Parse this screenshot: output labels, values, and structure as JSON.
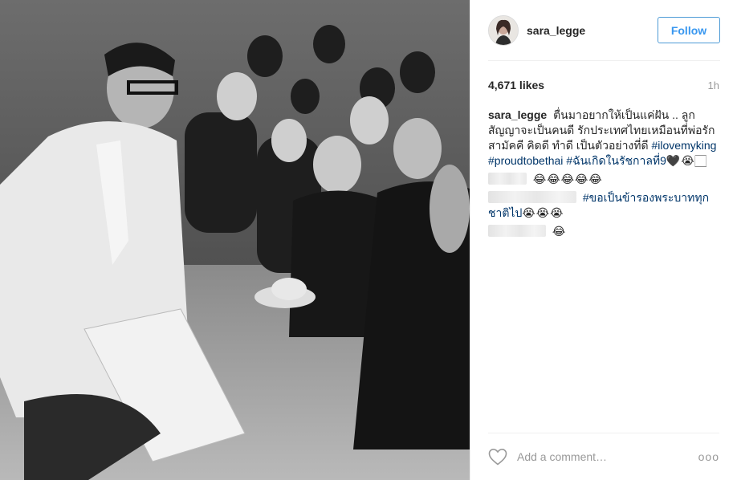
{
  "post": {
    "photo_alt": "",
    "header": {
      "username": "sara_legge",
      "follow_label": "Follow"
    },
    "likes": "4,671 likes",
    "time": "1h",
    "caption": {
      "username": "sara_legge",
      "text": "ตื่นมาอยากให้เป็นแค่ฝัน .. ลูกสัญญาจะเป็นคนดี รักประเทศไทยเหมือนที่พ่อรัก สามัคคี คิดดี ทำดี เป็นตัวอย่างที่ดี",
      "hashtags": [
        "#ilovemyking",
        "#proudtobethai",
        "#ฉันเกิดในรัชกาลที่9"
      ],
      "emoji": "🖤😭🏻"
    },
    "comments": [
      {
        "text": "😂😂😂😂😂"
      },
      {
        "hashtag": "#ขอเป็นข้ารองพระบาททุกชาติไป",
        "emoji": "😭😭😭"
      },
      {
        "text": "😂"
      }
    ],
    "add_comment_placeholder": "Add a comment…",
    "more_label": "ooo",
    "colors": {
      "follow": "#3897f0",
      "hashtag": "#003569",
      "muted": "#999999",
      "border": "#efefef"
    },
    "icons": [
      "heart-icon",
      "more-options-icon"
    ]
  }
}
